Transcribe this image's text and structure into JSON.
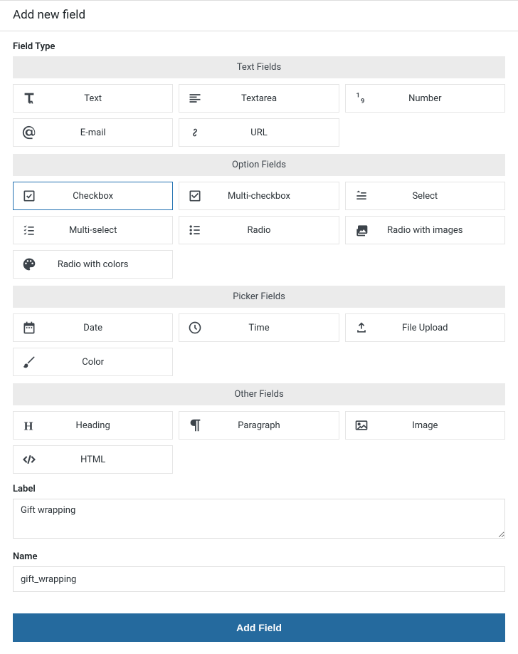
{
  "pageTitle": "Add new field",
  "fieldTypeLabel": "Field Type",
  "selectedFieldType": "checkbox",
  "groups": {
    "text": {
      "header": "Text Fields",
      "items": [
        {
          "key": "text",
          "label": "Text",
          "icon": "font-icon"
        },
        {
          "key": "textarea",
          "label": "Textarea",
          "icon": "align-left-icon"
        },
        {
          "key": "number",
          "label": "Number",
          "icon": "one-nine-icon"
        },
        {
          "key": "email",
          "label": "E-mail",
          "icon": "at-icon"
        },
        {
          "key": "url",
          "label": "URL",
          "icon": "link-icon"
        }
      ]
    },
    "option": {
      "header": "Option Fields",
      "items": [
        {
          "key": "checkbox",
          "label": "Checkbox",
          "icon": "checkbox-icon"
        },
        {
          "key": "multi-checkbox",
          "label": "Multi-checkbox",
          "icon": "multi-checkbox-icon"
        },
        {
          "key": "select",
          "label": "Select",
          "icon": "select-icon"
        },
        {
          "key": "multi-select",
          "label": "Multi-select",
          "icon": "multi-select-icon"
        },
        {
          "key": "radio",
          "label": "Radio",
          "icon": "radio-list-icon"
        },
        {
          "key": "radio-images",
          "label": "Radio with images",
          "icon": "images-icon"
        },
        {
          "key": "radio-colors",
          "label": "Radio with colors",
          "icon": "palette-icon"
        }
      ]
    },
    "picker": {
      "header": "Picker Fields",
      "items": [
        {
          "key": "date",
          "label": "Date",
          "icon": "calendar-icon"
        },
        {
          "key": "time",
          "label": "Time",
          "icon": "clock-icon"
        },
        {
          "key": "file",
          "label": "File Upload",
          "icon": "upload-icon"
        },
        {
          "key": "color",
          "label": "Color",
          "icon": "brush-icon"
        }
      ]
    },
    "other": {
      "header": "Other Fields",
      "items": [
        {
          "key": "heading",
          "label": "Heading",
          "icon": "heading-icon"
        },
        {
          "key": "paragraph",
          "label": "Paragraph",
          "icon": "pilcrow-icon"
        },
        {
          "key": "image",
          "label": "Image",
          "icon": "image-icon"
        },
        {
          "key": "html",
          "label": "HTML",
          "icon": "code-icon"
        }
      ]
    }
  },
  "labelField": {
    "label": "Label",
    "value": "Gift wrapping"
  },
  "nameField": {
    "label": "Name",
    "value": "gift_wrapping"
  },
  "submitLabel": "Add Field"
}
